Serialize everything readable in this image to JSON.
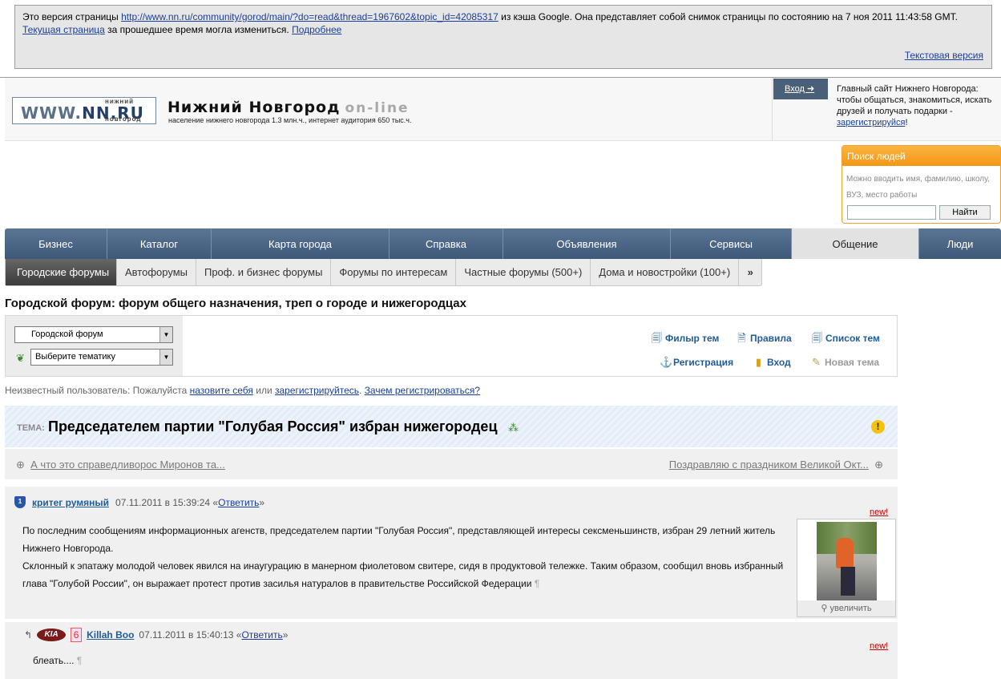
{
  "cache_banner": {
    "text1": "Это версия страницы ",
    "url": "http://www.nn.ru/community/gorod/main/?do=read&thread=1967602&topic_id=42085317",
    "text2": " из кэша Google. Она представляет собой снимок страницы по состоянию на 7 ноя 2011 11:43:58 GMT. ",
    "current_link": "Текущая страница",
    "text3": " за прошедшее время могла измениться. ",
    "more_link": "Подробнее",
    "text_version": "Текстовая версия"
  },
  "header": {
    "logo_top": "нижний",
    "logo_main_a": "WWW.",
    "logo_main_b": "NN.RU",
    "logo_bottom": "новгород",
    "site_title": "Нижний Новгород",
    "site_title_suffix": "on-line",
    "site_subtitle": "население нижнего новгорода 1.3 млн.ч., интернет аудитория 650 тыс.ч.",
    "login_button": "Вход ➜",
    "login_text": "Главный сайт Нижнего Новгорода: чтобы общаться, знакомиться, искать друзей и получать подарки - ",
    "register_link": "зарегистрируйся",
    "login_text_end": "!"
  },
  "people_search": {
    "title": "Поиск людей",
    "hint": "Можно вводить имя, фамилию, школу, ВУЗ, место работы",
    "input_value": "",
    "button": "Найти"
  },
  "main_nav": [
    {
      "label": "Бизнес",
      "active": false
    },
    {
      "label": "Каталог",
      "active": false
    },
    {
      "label": "Карта города",
      "active": false
    },
    {
      "label": "Справка",
      "active": false
    },
    {
      "label": "Объявления",
      "active": false
    },
    {
      "label": "Сервисы",
      "active": false
    },
    {
      "label": "Общение",
      "active": true
    },
    {
      "label": "Люди",
      "active": false
    }
  ],
  "sub_nav": [
    {
      "label": "Городские форумы",
      "active": true
    },
    {
      "label": "Автофорумы",
      "active": false
    },
    {
      "label": "Проф. и бизнес форумы",
      "active": false
    },
    {
      "label": "Форумы по интересам",
      "active": false
    },
    {
      "label": "Частные форумы (500+)",
      "active": false
    },
    {
      "label": "Дома и новостройки (100+)",
      "active": false
    },
    {
      "label": "»",
      "active": false
    }
  ],
  "forum_title": "Городской форум: форум общего назначения, треп о городе и нижегородцах",
  "tools": {
    "select1_value": "Городской форум",
    "select2_value": "Выберите тематику",
    "filter": "Филыр тем",
    "rules": "Правила",
    "topic_list": "Список тем",
    "registration": "Регистрация",
    "login": "Вход",
    "new_topic": "Новая тема"
  },
  "user_line": {
    "text1": "Неизвестный пользователь: Пожалуйста ",
    "link1": "назовите себя",
    "text2": " или ",
    "link2": "зарегистрируйтесь",
    "text3": ". ",
    "link3": "Зачем регистрироваться?"
  },
  "topic": {
    "label": "ТЕМА:",
    "title": "Председателем партии \"Голубая Россия\" избран нижегородец",
    "prev": "А что это справедливорос Миронов та...",
    "next": "Поздравляю с праздником Великой Окт..."
  },
  "posts": [
    {
      "badge": "1",
      "author": "критег румяный",
      "date": "07.11.2011 в 15:39:24",
      "reply_open": "«",
      "reply": "Ответить",
      "reply_close": "»",
      "new_label": "new!",
      "body1": "По последним сообщениям информационных агенств, председателем партии \"Голубая Россия\", представляющей интересы сексменьшинств, избран 29 летний житель Нижнего Новгорода.",
      "body2": "Склонный к эпатажу молодой человек явился на инаугурацию в манерном фиолетовом свитере, сидя в продуктовой тележке. Таким образом, сообщил вновь избранный глава \"Голубой России\", он выражает протест против засилья натуралов в правительстве Российской Федерации",
      "pilcrow": "¶",
      "photo_caption": "увеличить"
    },
    {
      "badge_logo": "KIA",
      "badge_num": "6",
      "author": "Killah Boo",
      "date": "07.11.2011 в 15:40:13",
      "reply_open": "«",
      "reply": "Ответить",
      "reply_close": "»",
      "new_label": "new!",
      "body": "блеать....",
      "pilcrow": "¶"
    }
  ]
}
